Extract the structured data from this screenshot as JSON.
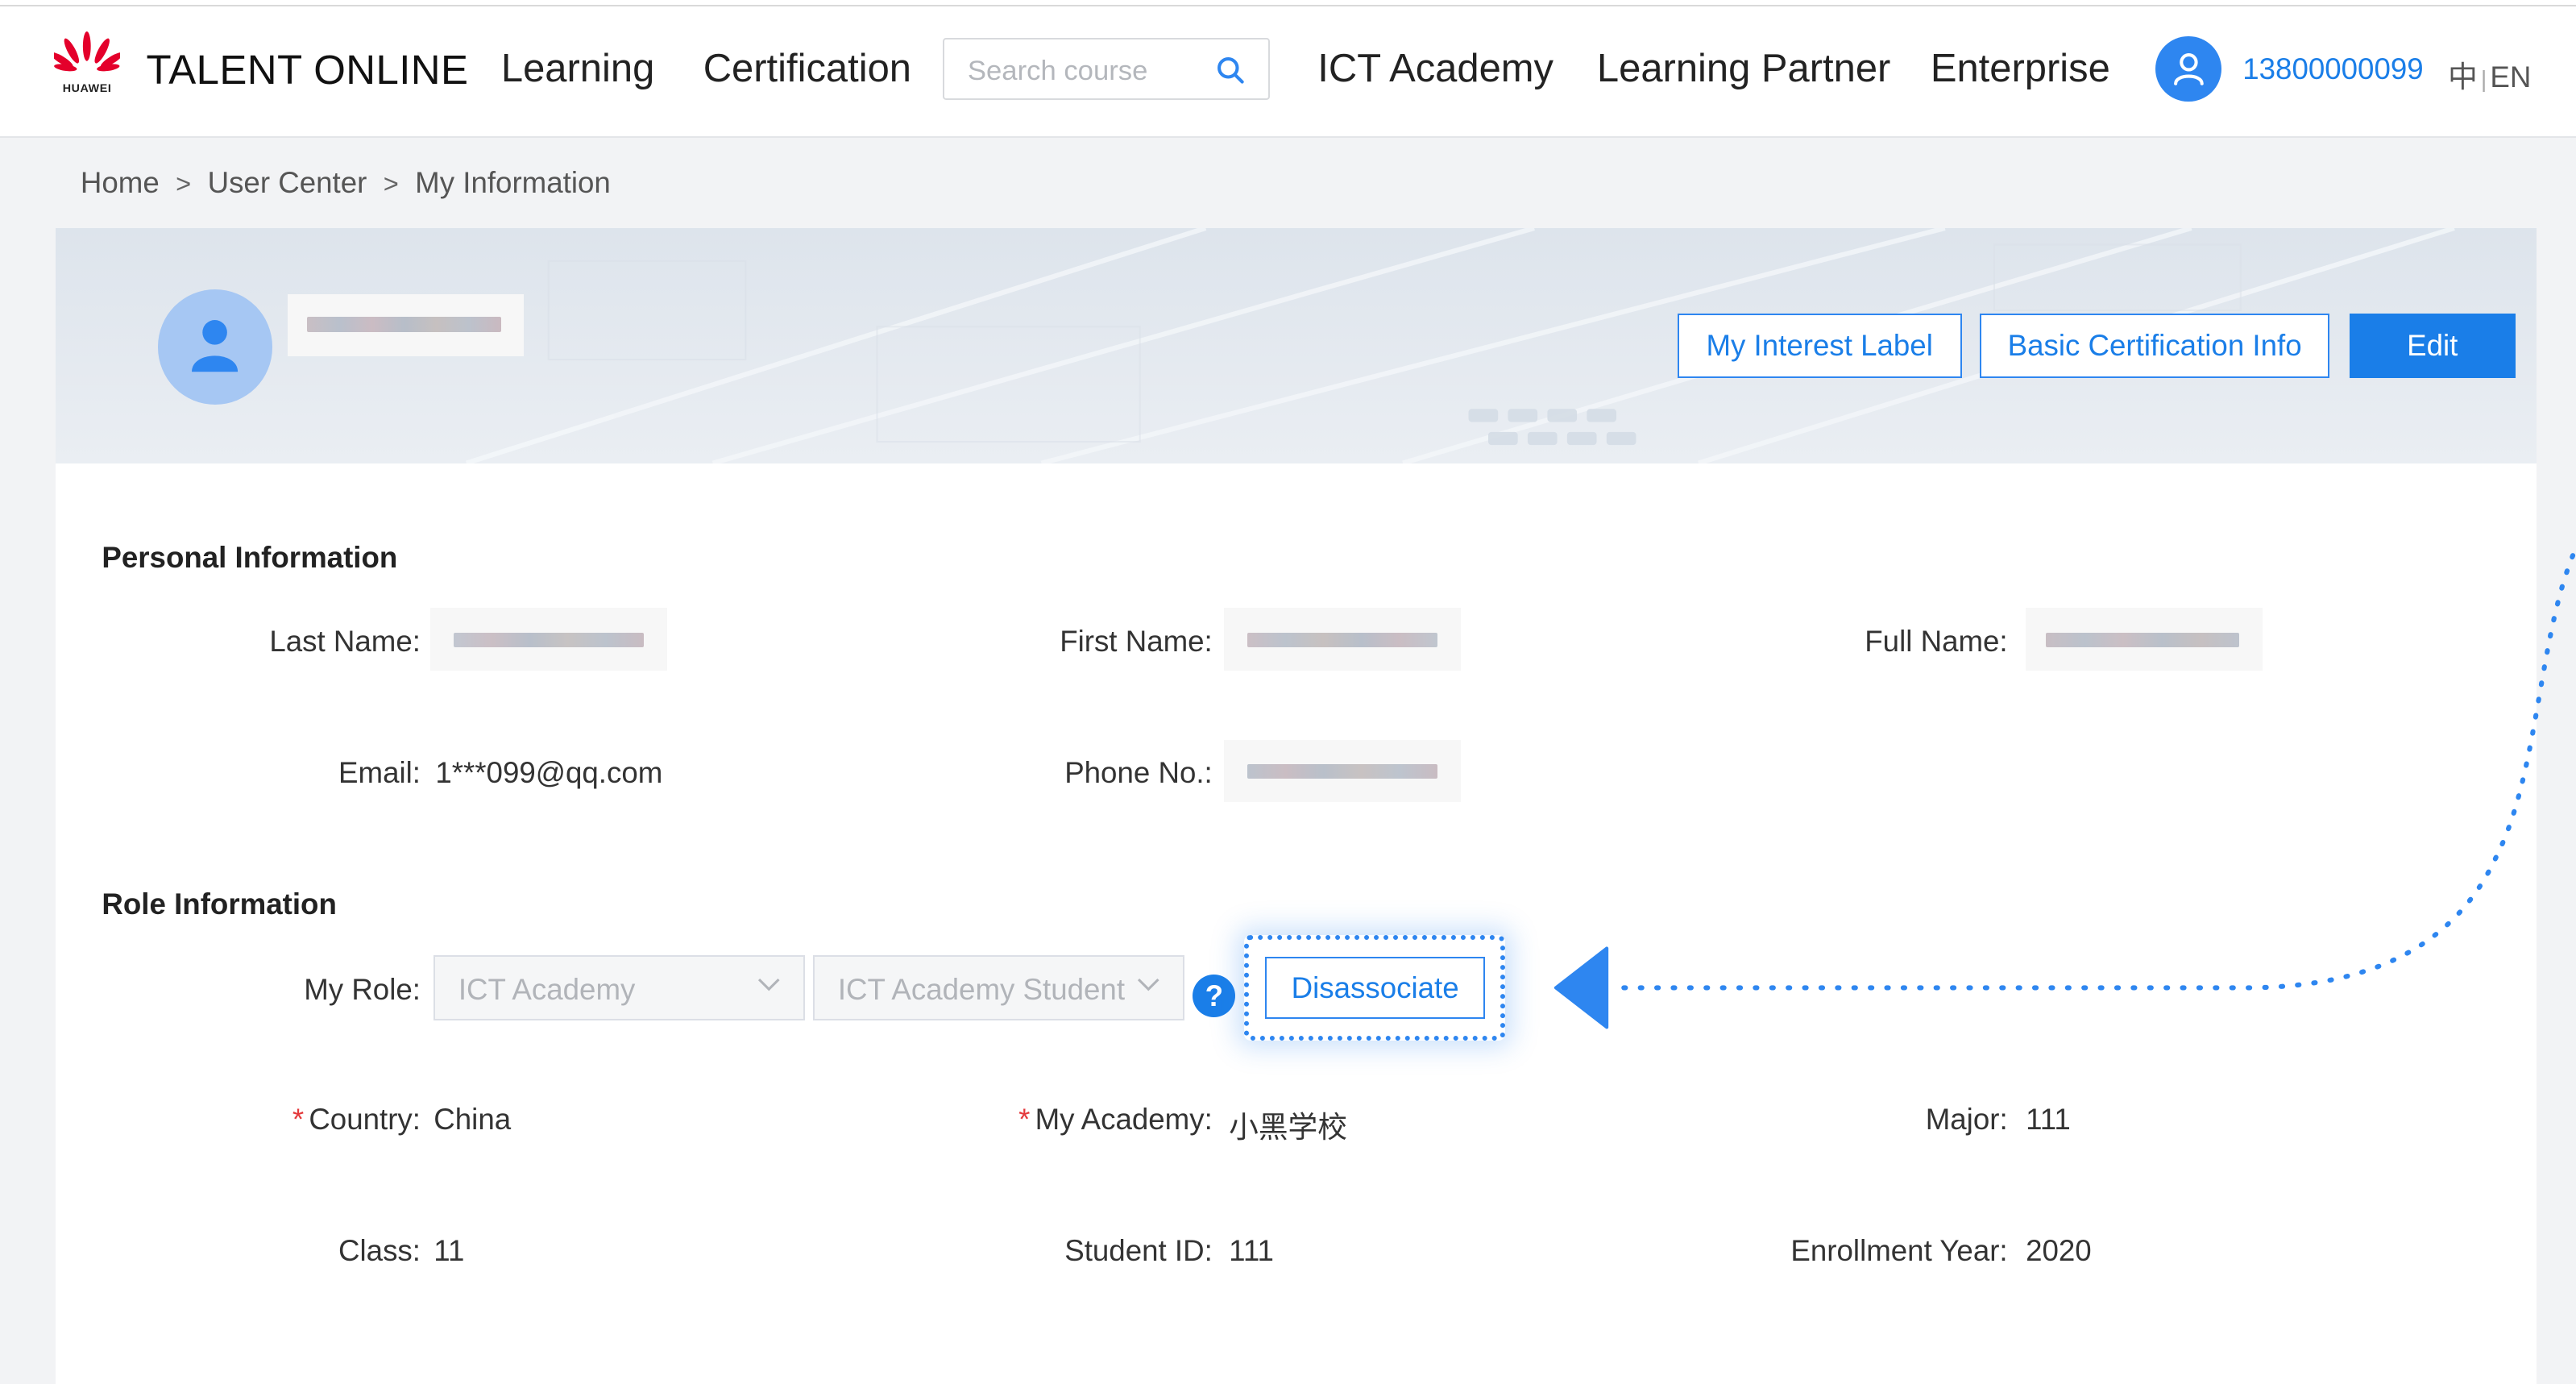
{
  "header": {
    "brand_text": "HUAWEI",
    "site_title": "TALENT ONLINE",
    "nav": {
      "learning": "Learning",
      "certification": "Certification",
      "ict_academy": "ICT Academy",
      "learning_partner": "Learning Partner",
      "enterprise": "Enterprise"
    },
    "search": {
      "placeholder": "Search course"
    },
    "user_phone": "13800000099",
    "lang_zh": "中",
    "lang_en": "EN"
  },
  "breadcrumb": {
    "home": "Home",
    "user_center": "User Center",
    "current": "My Information",
    "separator": ">"
  },
  "profile": {
    "buttons": {
      "interest": "My Interest Label",
      "basic_cert": "Basic Certification Info",
      "edit": "Edit"
    }
  },
  "personal": {
    "title": "Personal Information",
    "last_name_label": "Last Name:",
    "first_name_label": "First Name:",
    "full_name_label": "Full Name:",
    "email_label": "Email:",
    "email_value": "1***099@qq.com",
    "phone_label": "Phone No.:"
  },
  "role": {
    "title": "Role Information",
    "my_role_label": "My Role:",
    "role_select_1": "ICT Academy",
    "role_select_2": "ICT Academy Student",
    "help": "?",
    "disassociate": "Disassociate",
    "required_mark": "*",
    "country_label": "Country:",
    "country_value": "China",
    "academy_label": "My Academy:",
    "academy_value": "小黑学校",
    "major_label": "Major:",
    "major_value": "111",
    "class_label": "Class:",
    "class_value": "11",
    "student_id_label": "Student ID:",
    "student_id_value": "111",
    "enroll_label": "Enrollment Year:",
    "enroll_value": "2020"
  },
  "colors": {
    "accent": "#1a7ee8",
    "required": "#e4393c",
    "banner": "#e1e7ee",
    "avatar": "#a6c7f3"
  },
  "icons": {
    "search": "search-icon",
    "user": "user-icon",
    "help": "question-icon",
    "chevron": "chevron-down-icon",
    "logo": "huawei-logo"
  }
}
